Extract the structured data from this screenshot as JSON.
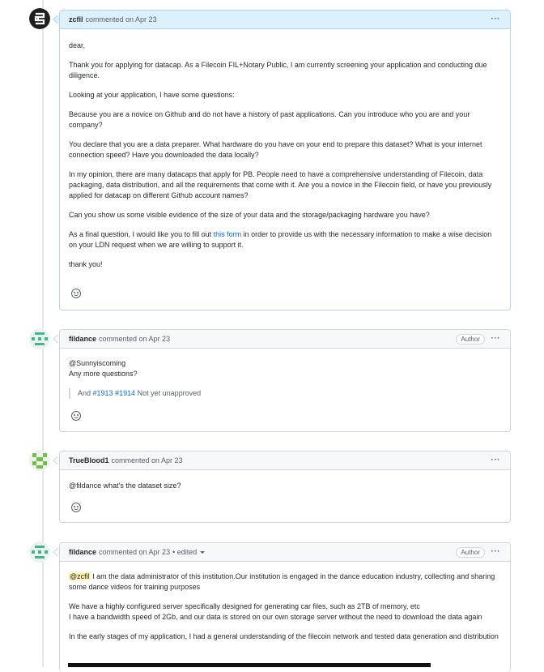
{
  "comments": [
    {
      "author": "zcfil",
      "meta": "commented on Apr 23",
      "paragraphs": {
        "p1": "dear,",
        "p2": "Thank you for applying for datacap. As a Filecoin FIL+Notary Public, I am currently screening your application and conducting due diligence.",
        "p3": "Looking at your application, I have some questions:",
        "p4": "Because you are a novice on Github and do not have a history of past applications. Can you introduce who you are and your company?",
        "p5": "You declare that you are a data preparer. What hardware do you have on your end to prepare this dataset? What is your internet connection speed? Have you downloaded the data locally?",
        "p6": "In my opinion, there are many datacaps that apply for PB. People need to have a comprehensive understanding of Filecoin, data packaging, data distribution, and all the requirements that come with it. Are you a novice in the Filecoin field, or have you previously applied for datacap on different Github account names?",
        "p7": "Can you show us some visible evidence of the size of your data and the storage/packaging hardware you have?",
        "p8_before": "As a final question, I would like you to fill out ",
        "p8_link": "this form",
        "p8_after": " in order to provide us with the necessary information to make a wise decision on your LDN request when we are willing to support it.",
        "p9": "thank you!"
      }
    },
    {
      "author": "fildance",
      "meta": "commented on Apr 23",
      "badge": "Author",
      "mention": "@Sunnyiscoming",
      "line2": "Any more questions?",
      "quote_and": "And",
      "quote_link1": "#1913",
      "quote_link2": "#1914",
      "quote_rest": "Not yet unapproved"
    },
    {
      "author": "TrueBlood1",
      "meta": "commented on Apr 23",
      "mention": "@fildance",
      "text": " what's the dataset size?"
    },
    {
      "author": "fildance",
      "meta": "commented on Apr 23",
      "edited": "• edited",
      "badge": "Author",
      "mention": "@zcfil",
      "p1": " I am the data administrator of this institution.Our institution is engaged in the dance education industry, collecting and sharing some dance videos for training purposes",
      "p2a": "We have a highly configured server specifically designed for generating car files, such as 2TB of memory, etc",
      "p2b": "I have a bandwidth speed of 2Gb, and our data is stored on our own storage server without the need to download the data again",
      "p3": "In the early stages of my application, I had a general understanding of the filecoin network and tested data generation and distribution"
    }
  ],
  "ui": {
    "kebab": "···"
  },
  "colors": {
    "link": "#0969da",
    "own_header": "#ddf1fc",
    "avatar_green": "#3fb98a"
  }
}
